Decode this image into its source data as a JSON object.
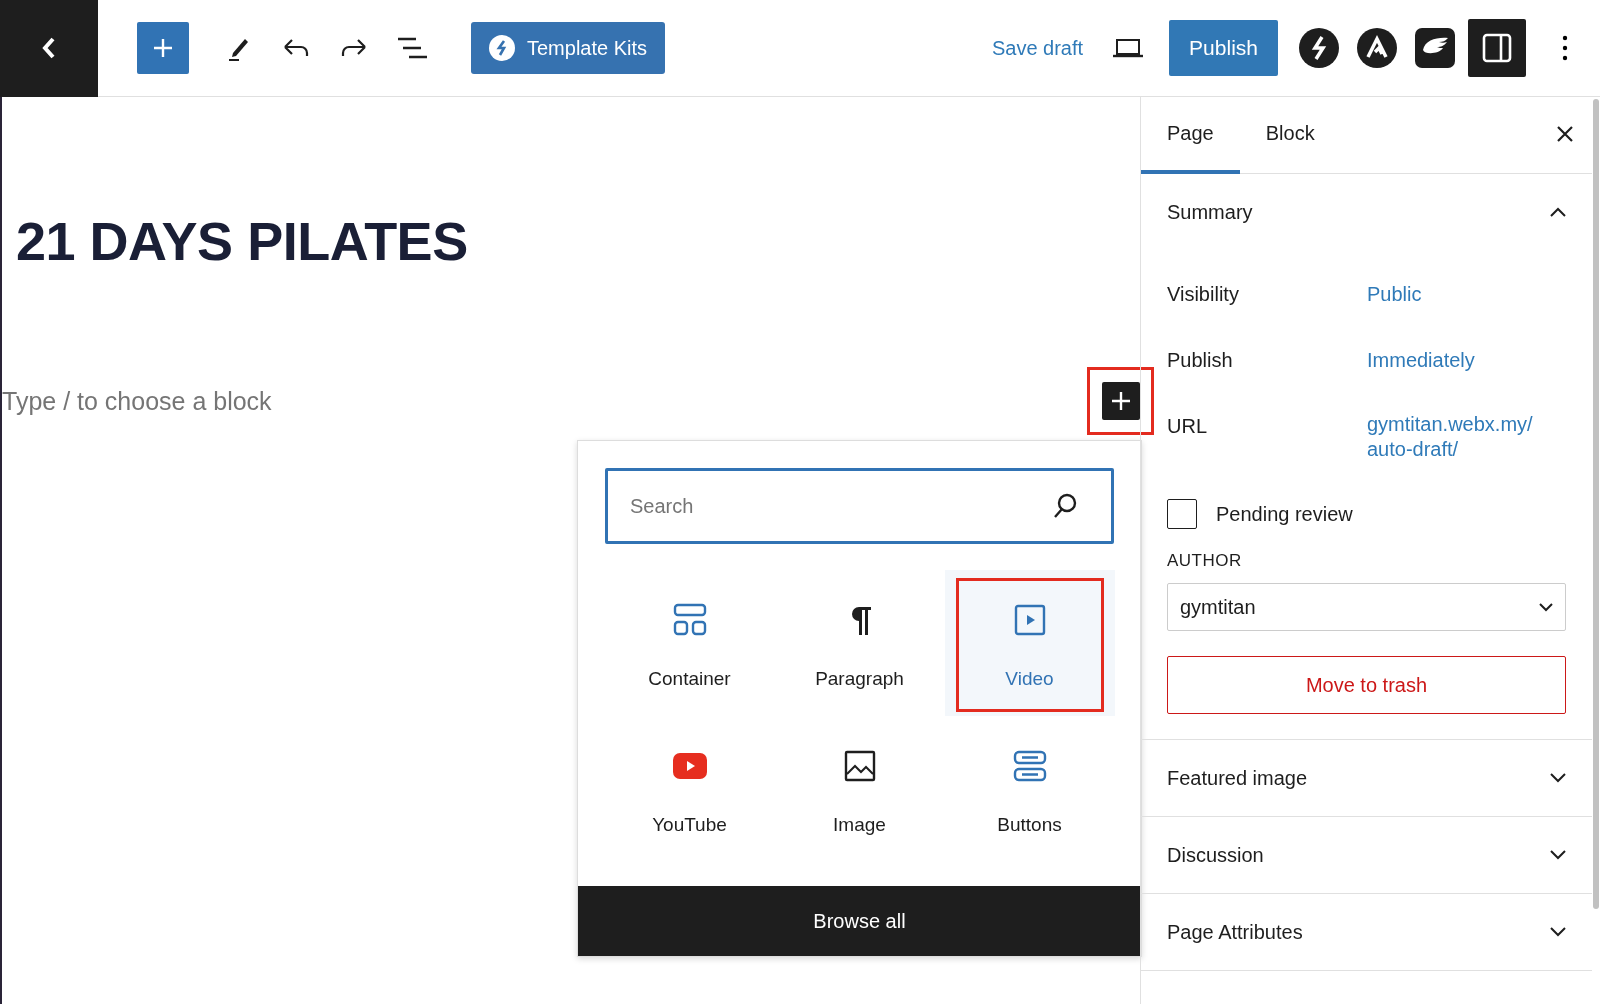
{
  "toolbar": {
    "template_kits": "Template Kits",
    "save_draft": "Save draft",
    "publish": "Publish",
    "settings_active": true
  },
  "editor": {
    "title": "21 DAYS PILATES",
    "placeholder": "Type / to choose a block",
    "inserter_highlighted": true
  },
  "inserter": {
    "search": {
      "placeholder": "Search"
    },
    "blocks": [
      {
        "kind": "container",
        "label": "Container",
        "selected": false,
        "highlighted": false
      },
      {
        "kind": "paragraph",
        "label": "Paragraph",
        "selected": false,
        "highlighted": false
      },
      {
        "kind": "video",
        "label": "Video",
        "selected": true,
        "highlighted": true
      },
      {
        "kind": "youtube",
        "label": "YouTube",
        "selected": false,
        "highlighted": false
      },
      {
        "kind": "image",
        "label": "Image",
        "selected": false,
        "highlighted": false
      },
      {
        "kind": "buttons",
        "label": "Buttons",
        "selected": false,
        "highlighted": false
      }
    ],
    "browse_all": "Browse all"
  },
  "sidebar": {
    "tabs": [
      {
        "label": "Page",
        "selected": true
      },
      {
        "label": "Block",
        "selected": false
      }
    ],
    "summary": {
      "title": "Summary",
      "expanded": true,
      "rows": [
        {
          "label": "Visibility",
          "value": "Public"
        },
        {
          "label": "Publish",
          "value": "Immediately"
        },
        {
          "label": "URL",
          "value": "gymtitan.webx.my/auto-draft/"
        }
      ],
      "pending_review": {
        "label": "Pending review",
        "checked": false
      },
      "author": {
        "label": "AUTHOR",
        "value": "gymtitan"
      },
      "trash": "Move to trash"
    },
    "panels": [
      {
        "title": "Featured image",
        "expanded": false
      },
      {
        "title": "Discussion",
        "expanded": false
      },
      {
        "title": "Page Attributes",
        "expanded": false
      }
    ]
  }
}
